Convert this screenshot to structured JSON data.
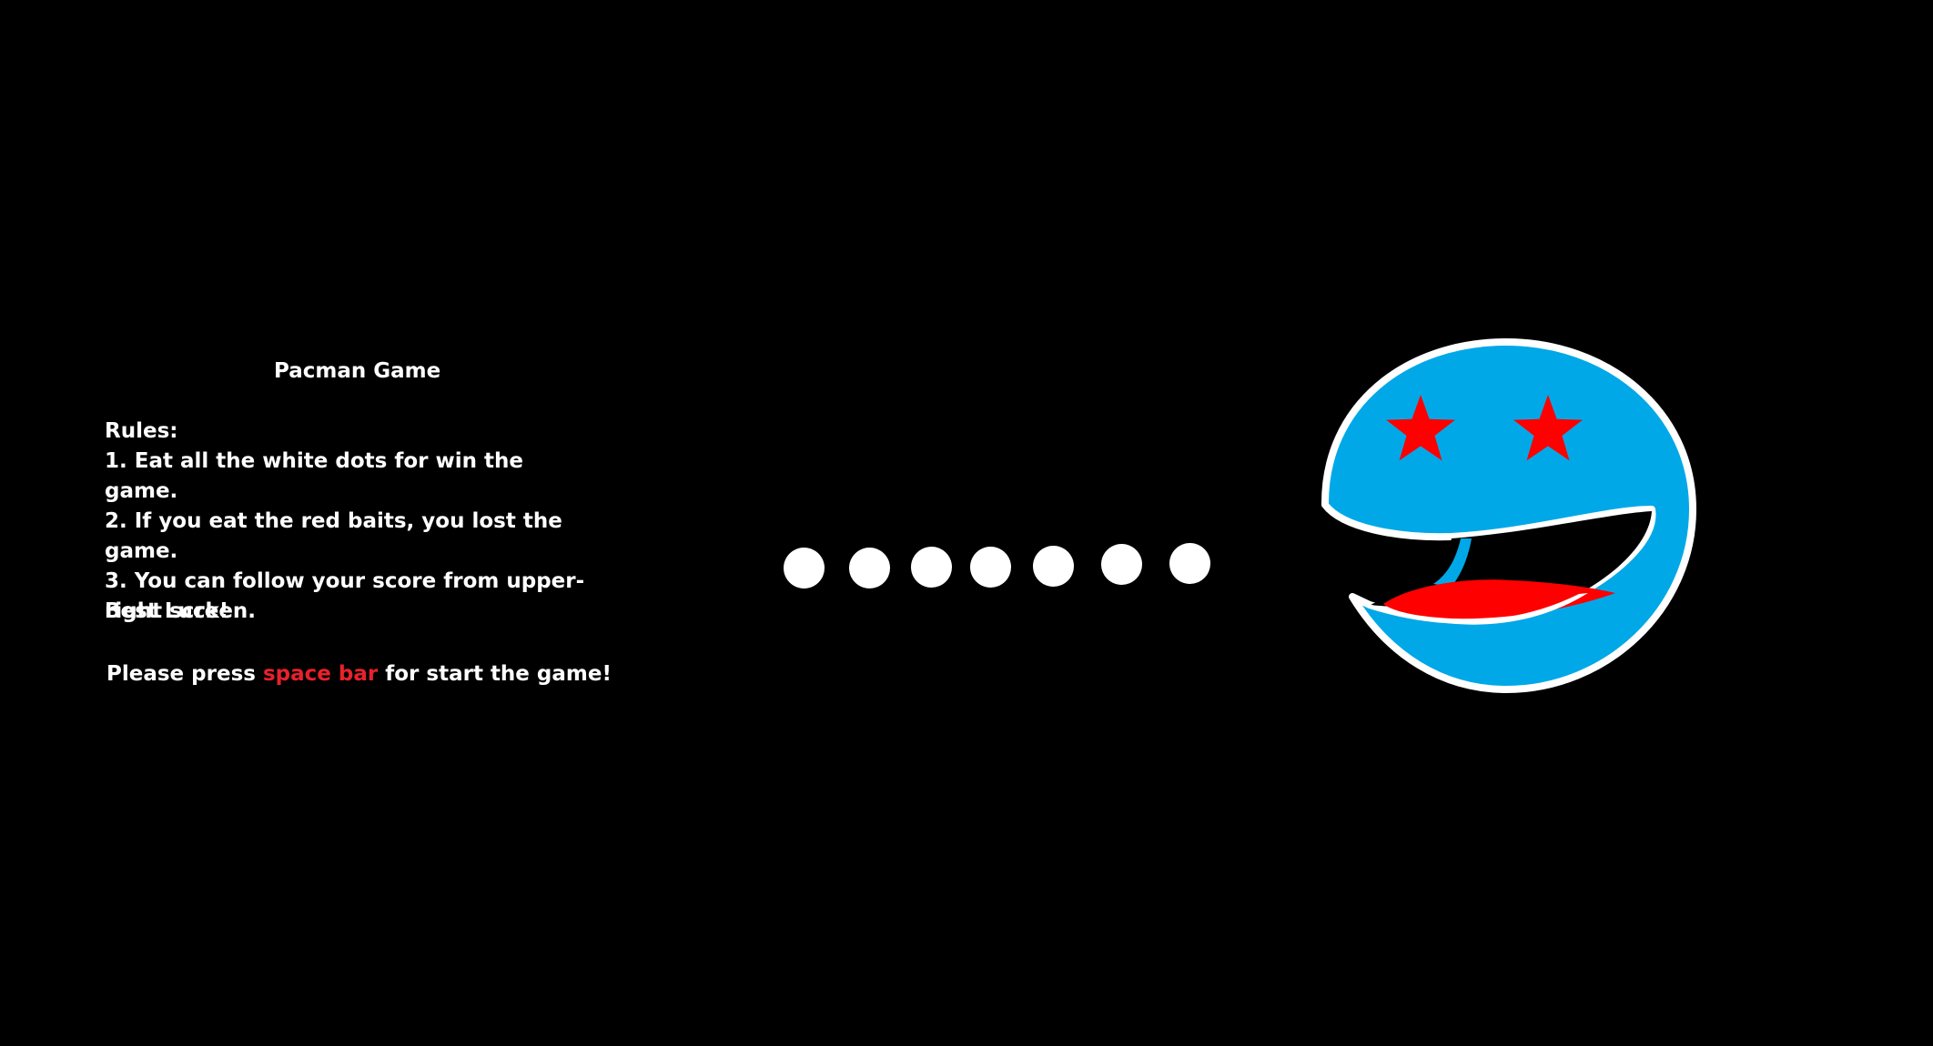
{
  "intro": {
    "title": "Pacman Game",
    "rules_heading": "Rules:",
    "rules": [
      "1. Eat all the white dots for win the game.",
      "2. If you eat the red baits, you lost the game.",
      "3. You can follow your score from upper-right screen."
    ],
    "closing": "Best Luck!",
    "prompt": {
      "before": "Please press",
      "key": "space bar",
      "after": "for start the game!"
    }
  },
  "scene": {
    "dots_count_visible": 7,
    "pacman_icon": "pacman-character-icon",
    "eye_icon": "star-eye-icon",
    "colors": {
      "background": "#000000",
      "text": "#ffffff",
      "highlight": "#e8212b",
      "dot": "#ffffff",
      "pacman_body": "#00a8e8",
      "pacman_outline": "#ffffff",
      "pacman_stars": "#ff0000",
      "pacman_tongue": "#ff0000"
    }
  }
}
